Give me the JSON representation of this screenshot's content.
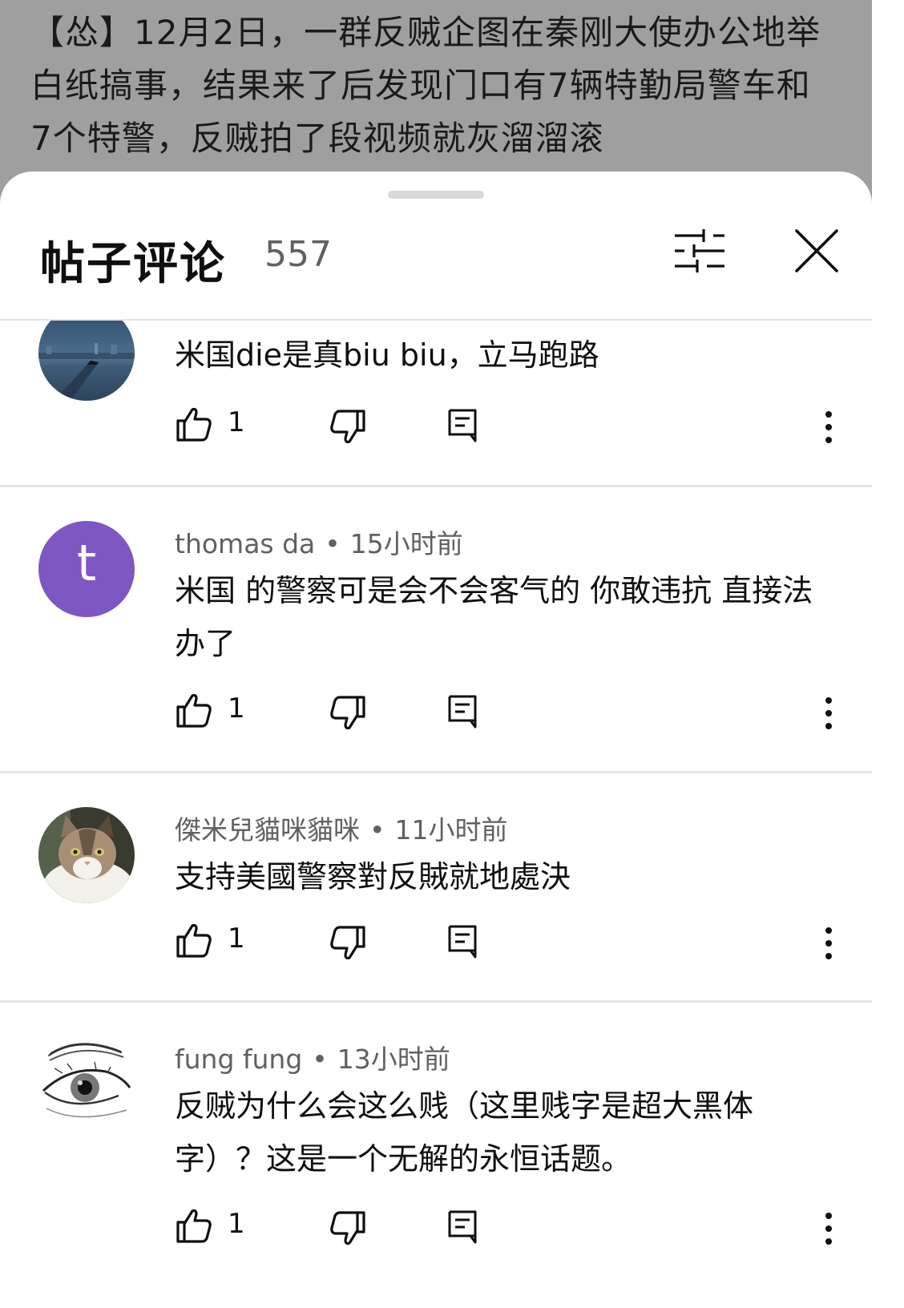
{
  "post": {
    "text": "【怂】12月2日，一群反贼企图在秦刚大使办公地举白纸搞事，结果来了后发现门口有7辆特勤局警车和7个特警，反贼拍了段视频就灰溜溜滚"
  },
  "sheet": {
    "title": "帖子评论",
    "count": "557",
    "icons": {
      "filter": "sliders-icon",
      "close": "close-icon"
    }
  },
  "comments": [
    {
      "author": "",
      "time": "",
      "text": "米国die是真biu biu，立马跑路",
      "likes": "1",
      "avatar_desc": "harbor-night-photo"
    },
    {
      "author": "thomas da",
      "time": "15小时前",
      "text": "米国 的警察可是会不会客气的 你敢违抗 直接法办了",
      "likes": "1",
      "avatar_letter": "t",
      "avatar_color": "#7e57c2"
    },
    {
      "author": "傑米兒貓咪貓咪",
      "time": "11小时前",
      "text": "支持美國警察對反賊就地處決",
      "likes": "1",
      "avatar_desc": "cat-photo"
    },
    {
      "author": "fung fung",
      "time": "13小时前",
      "text": "反贼为什么会这么贱（这里贱字是超大黑体字）？这是一个无解的永恒话题。",
      "likes": "1",
      "avatar_desc": "eye-sketch"
    }
  ],
  "icons": {
    "like": "thumb-up-icon",
    "dislike": "thumb-down-icon",
    "reply": "reply-icon",
    "more": "more-vert-icon"
  }
}
